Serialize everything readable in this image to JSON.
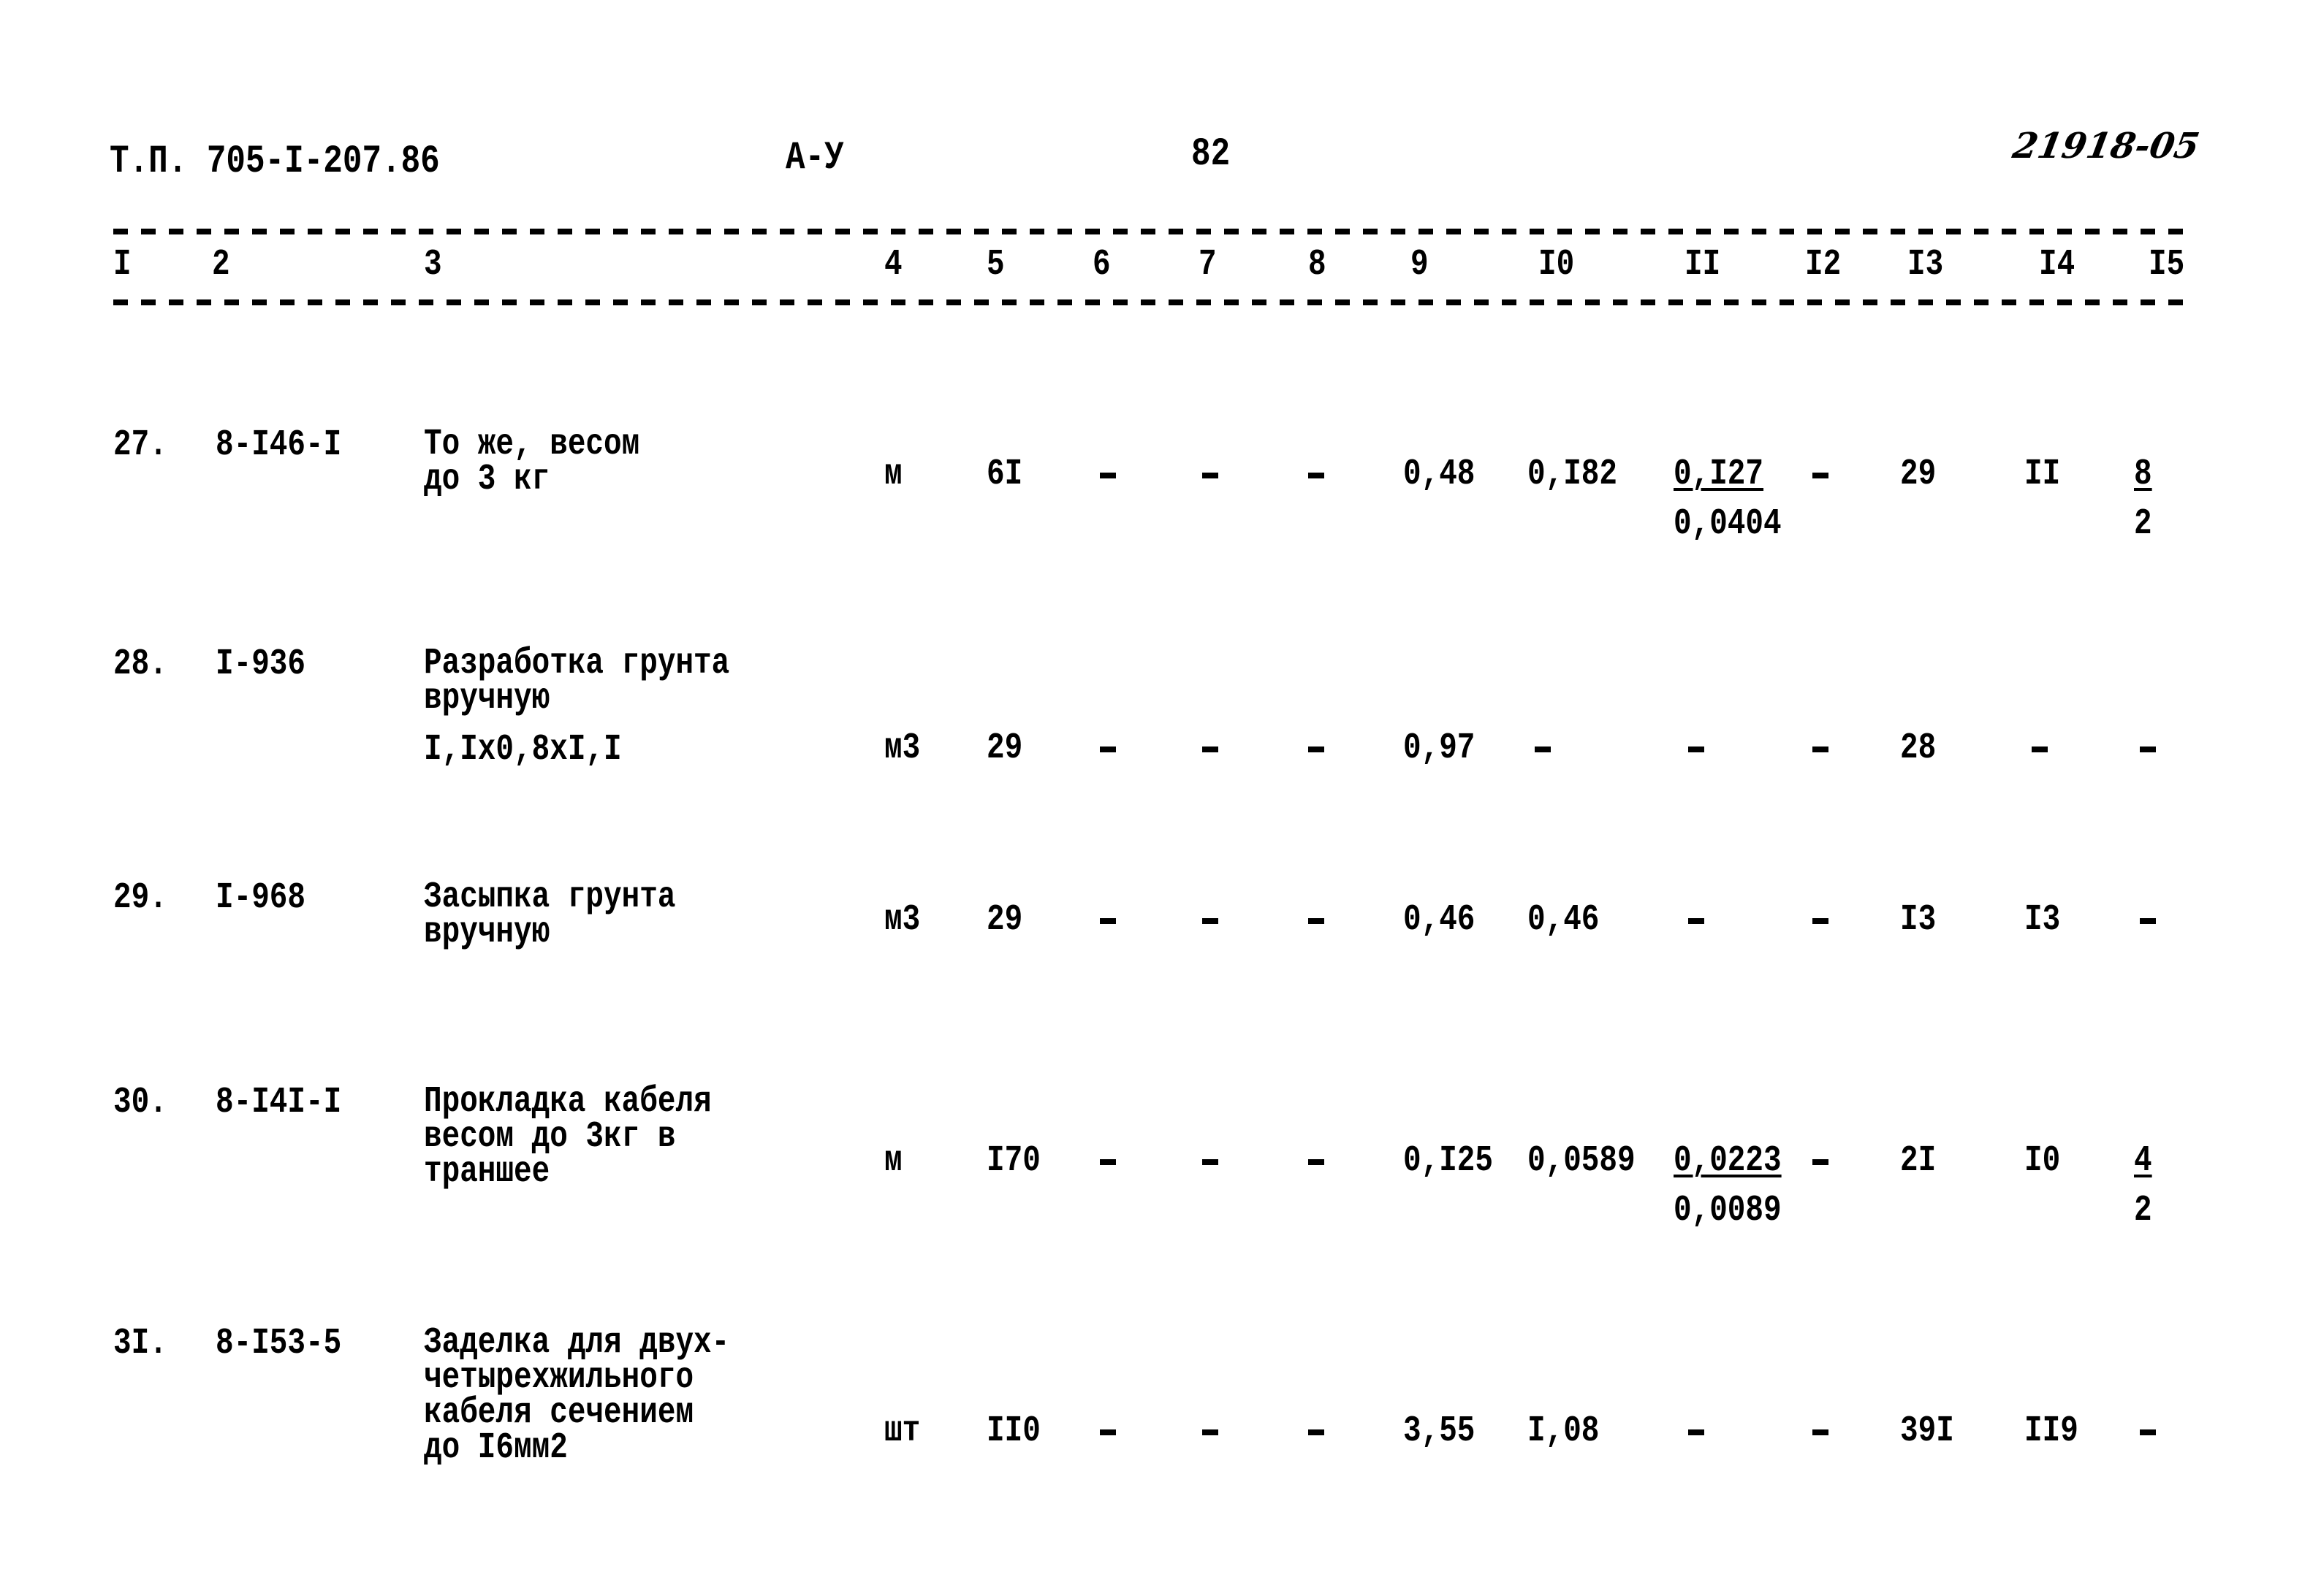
{
  "header": {
    "doc_code": "Т.П. 705-I-207.86",
    "section": "А-У",
    "page_number": "82",
    "handwritten_ref": "21918-05"
  },
  "columns": [
    "I",
    "2",
    "3",
    "4",
    "5",
    "6",
    "7",
    "8",
    "9",
    "I0",
    "II",
    "I2",
    "I3",
    "I4",
    "I5"
  ],
  "rows": [
    {
      "num": "27.",
      "code": "8-I46-I",
      "desc": [
        "То же, весом",
        "до 3 кг"
      ],
      "unit": "м",
      "qty": "6I",
      "c6": "-",
      "c7": "-",
      "c8": "-",
      "c9": "0,48",
      "c10": "0,I82",
      "c11_top": "0,I27",
      "c11_bottom": "0,0404",
      "c12": "-",
      "c13": "29",
      "c14": "II",
      "c15_top": "8",
      "c15_bottom": "2"
    },
    {
      "num": "28.",
      "code": "I-936",
      "desc": [
        "Разработка грунта",
        "вручную",
        "I,Iх0,8хI,I"
      ],
      "unit": "м3",
      "qty": "29",
      "c6": "-",
      "c7": "-",
      "c8": "-",
      "c9": "0,97",
      "c10": "-",
      "c11_top": "-",
      "c11_bottom": "",
      "c12": "-",
      "c13": "28",
      "c14": "-",
      "c15_top": "-",
      "c15_bottom": ""
    },
    {
      "num": "29.",
      "code": "I-968",
      "desc": [
        "Засыпка грунта",
        "вручную"
      ],
      "unit": "м3",
      "qty": "29",
      "c6": "-",
      "c7": "-",
      "c8": "-",
      "c9": "0,46",
      "c10": "0,46",
      "c11_top": "-",
      "c11_bottom": "",
      "c12": "-",
      "c13": "I3",
      "c14": "I3",
      "c15_top": "-",
      "c15_bottom": ""
    },
    {
      "num": "30.",
      "code": "8-I4I-I",
      "desc": [
        "Прокладка кабеля",
        "весом до 3кг в",
        "траншее"
      ],
      "unit": "м",
      "qty": "I70",
      "c6": "-",
      "c7": "-",
      "c8": "-",
      "c9": "0,I25",
      "c10": "0,0589",
      "c11_top": "0,0223",
      "c11_bottom": "0,0089",
      "c12": "-",
      "c13": "2I",
      "c14": "I0",
      "c15_top": "4",
      "c15_bottom": "2"
    },
    {
      "num": "3I.",
      "code": "8-I53-5",
      "desc": [
        "Заделка для двух-",
        "четырехжильного",
        "кабеля сечением",
        "до I6мм2"
      ],
      "unit": "шт",
      "qty": "II0",
      "c6": "-",
      "c7": "-",
      "c8": "-",
      "c9": "3,55",
      "c10": "I,08",
      "c11_top": "-",
      "c11_bottom": "",
      "c12": "-",
      "c13": "39I",
      "c14": "II9",
      "c15_top": "-",
      "c15_bottom": ""
    }
  ]
}
